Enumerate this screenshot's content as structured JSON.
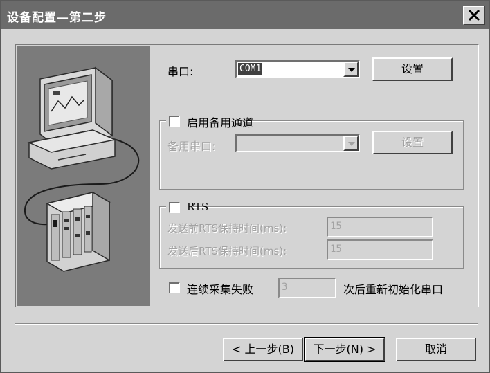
{
  "window": {
    "title": "设备配置—第二步"
  },
  "serial": {
    "label": "串口:",
    "value": "COM1",
    "settings_label": "设置"
  },
  "backup": {
    "checkbox_label": "启用备用通道",
    "serial_label": "备用串口:",
    "value": "",
    "settings_label": "设置"
  },
  "rts": {
    "checkbox_label": "RTS",
    "before_label": "发送前RTS保持时间(ms):",
    "before_value": "15",
    "after_label": "发送后RTS保持时间(ms):",
    "after_value": "15"
  },
  "retry": {
    "checkbox_label": "连续采集失败",
    "value": "3",
    "suffix_label": "次后重新初始化串口"
  },
  "buttons": {
    "prev": "< 上一步(B)",
    "next": "下一步(N) >",
    "cancel": "取消"
  },
  "icons": [
    "close-icon",
    "dropdown-arrow-icon",
    "computer-icon",
    "device-icon"
  ],
  "colors": {
    "titlebar": "#6b6b6b",
    "face": "#d4d4d4",
    "illustration_bg": "#7b7b7b",
    "disabled_text": "#a2a2a2"
  }
}
